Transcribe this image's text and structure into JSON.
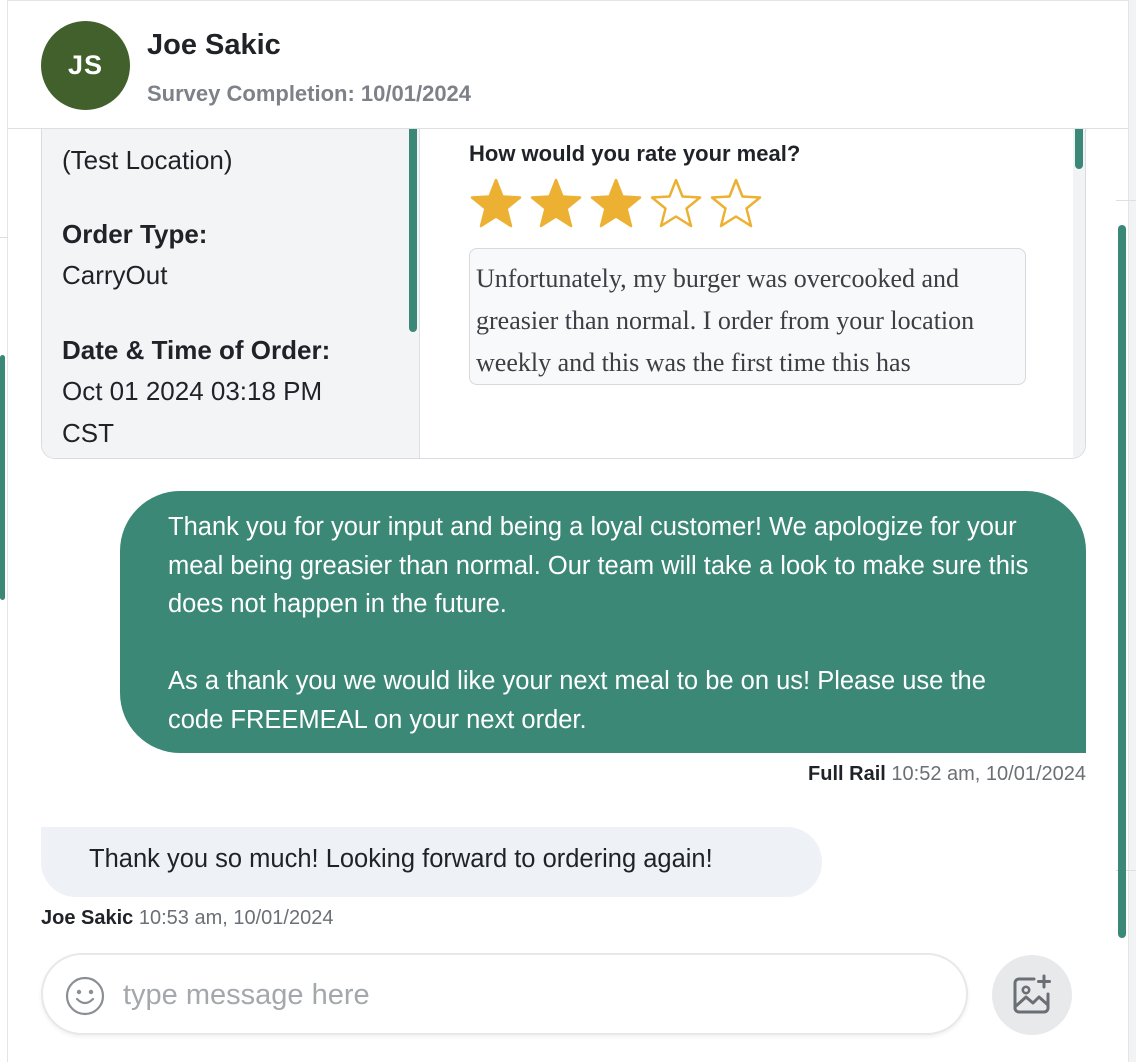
{
  "header": {
    "avatar_initials": "JS",
    "name": "Joe Sakic",
    "subtitle": "Survey Completion: 10/01/2024"
  },
  "survey": {
    "location": "(Test Location)",
    "order_type_label": "Order Type:",
    "order_type_value": "CarryOut",
    "datetime_label": "Date & Time of Order:",
    "datetime_value_line1": "Oct 01 2024 03:18 PM",
    "datetime_value_line2": "CST",
    "question": "How would you rate your meal?",
    "rating": 3,
    "rating_max": 5,
    "feedback": "Unfortunately, my burger was overcooked and greasier than normal. I order from your location weekly and this was the first time this has"
  },
  "messages": [
    {
      "direction": "outgoing",
      "paragraph1": "Thank you for your input and being a loyal customer! We apologize for your meal being greasier than normal. Our team will take a look to make sure this does not happen in the future.",
      "paragraph2": "As a thank you we would like your next meal to be on us! Please use the code FREEMEAL on your next order.",
      "sender": "Full Rail",
      "time": "10:52 am, 10/01/2024"
    },
    {
      "direction": "incoming",
      "text": "Thank you so much! Looking forward to ordering again!",
      "sender": "Joe Sakic",
      "time": "10:53 am, 10/01/2024"
    }
  ],
  "composer": {
    "placeholder": "type message here",
    "value": ""
  },
  "colors": {
    "accent": "#3c8877",
    "avatar_bg": "#41602b",
    "star": "#ecb033",
    "incoming_bubble": "#eef1f5"
  },
  "icons": {
    "emoji": "smiley-face-icon",
    "attach": "add-image-icon",
    "star_filled": "star-filled-icon",
    "star_empty": "star-outline-icon"
  }
}
